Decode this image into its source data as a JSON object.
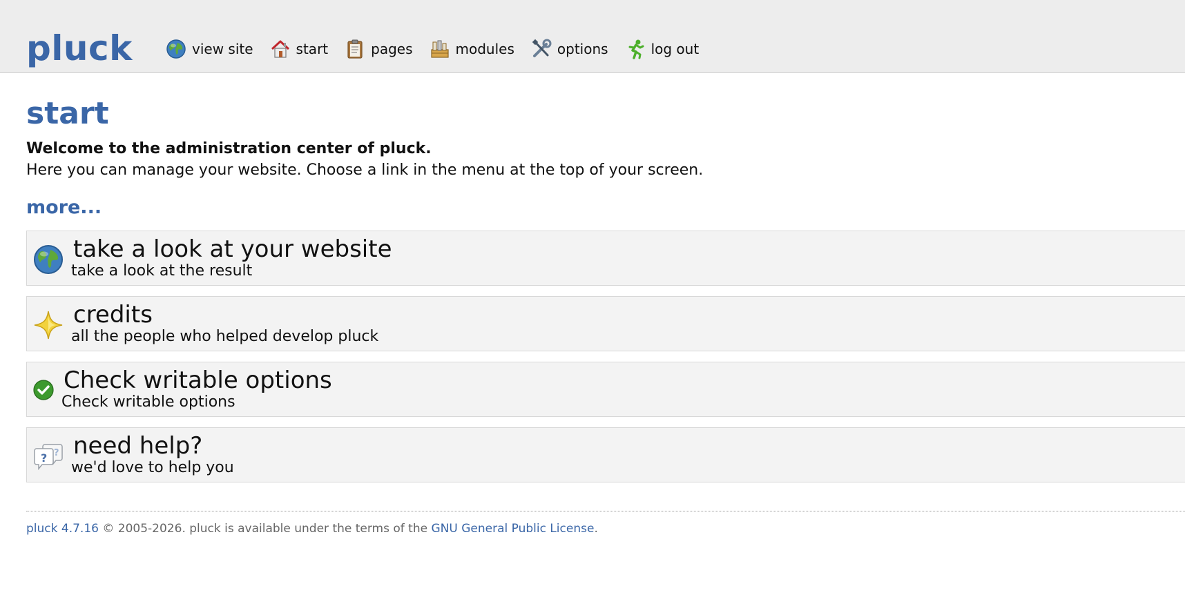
{
  "header": {
    "logo": "pluck",
    "nav": [
      {
        "label": "view site",
        "icon": "globe-icon"
      },
      {
        "label": "start",
        "icon": "home-icon"
      },
      {
        "label": "pages",
        "icon": "clipboard-icon"
      },
      {
        "label": "modules",
        "icon": "modules-icon"
      },
      {
        "label": "options",
        "icon": "tools-icon"
      },
      {
        "label": "log out",
        "icon": "running-man-icon"
      }
    ]
  },
  "main": {
    "title": "start",
    "welcome_bold": "Welcome to the administration center of pluck.",
    "welcome_text": "Here you can manage your website. Choose a link in the menu at the top of your screen.",
    "more": "more...",
    "boxes": [
      {
        "title": "take a look at your website",
        "subtitle": "take a look at the result",
        "icon": "globe-icon"
      },
      {
        "title": "credits",
        "subtitle": "all the people who helped develop pluck",
        "icon": "star-icon"
      },
      {
        "title": "Check writable options",
        "subtitle": "Check writable options",
        "icon": "check-icon"
      },
      {
        "title": "need help?",
        "subtitle": "we'd love to help you",
        "icon": "help-bubbles-icon"
      }
    ]
  },
  "footer": {
    "version_link": "pluck 4.7.16",
    "text": " © 2005-2026. pluck is available under the terms of the ",
    "license_link": "GNU General Public License",
    "end": "."
  },
  "colors": {
    "brand_blue": "#3a66a7",
    "header_bg": "#ededed",
    "box_bg": "#f3f3f3"
  }
}
